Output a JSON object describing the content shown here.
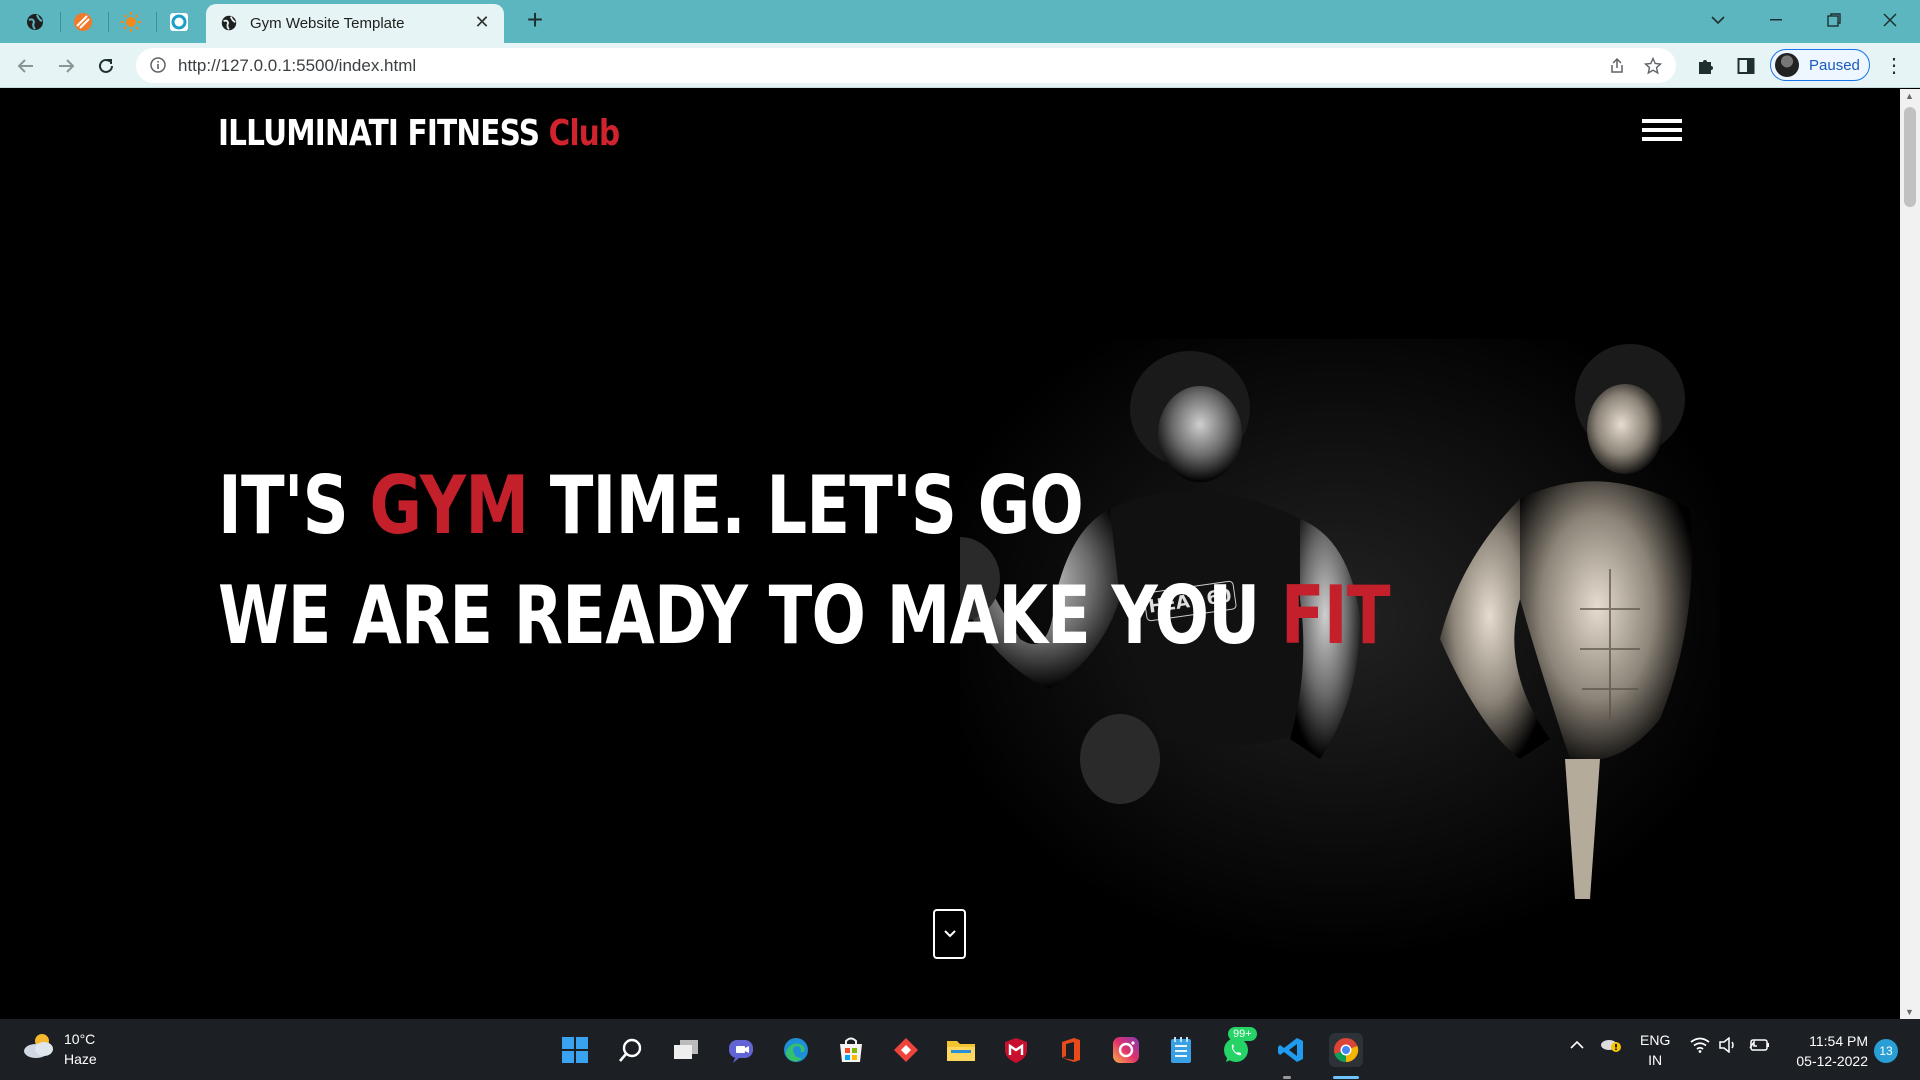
{
  "browser": {
    "active_tab_title": "Gym Website Template",
    "new_tab_symbol": "+",
    "url": "http://127.0.0.1:5500/index.html",
    "profile_status": "Paused"
  },
  "site": {
    "brand_main": "ILLUMINATI FITNESS",
    "brand_accent": "Club",
    "hero_line1_a": "IT'S",
    "hero_line1_accent": "GYM",
    "hero_line1_b": "TIME. LET'S GO",
    "hero_line2_a": "WE ARE READY TO MAKE YOU",
    "hero_line2_accent": "FIT",
    "accent_color": "#c3202b"
  },
  "taskbar": {
    "temperature": "10°C",
    "weather": "Haze",
    "whatsapp_badge": "99+",
    "language": "ENG",
    "region": "IN",
    "time": "11:54 PM",
    "date": "05-12-2022",
    "notifications": "13"
  }
}
